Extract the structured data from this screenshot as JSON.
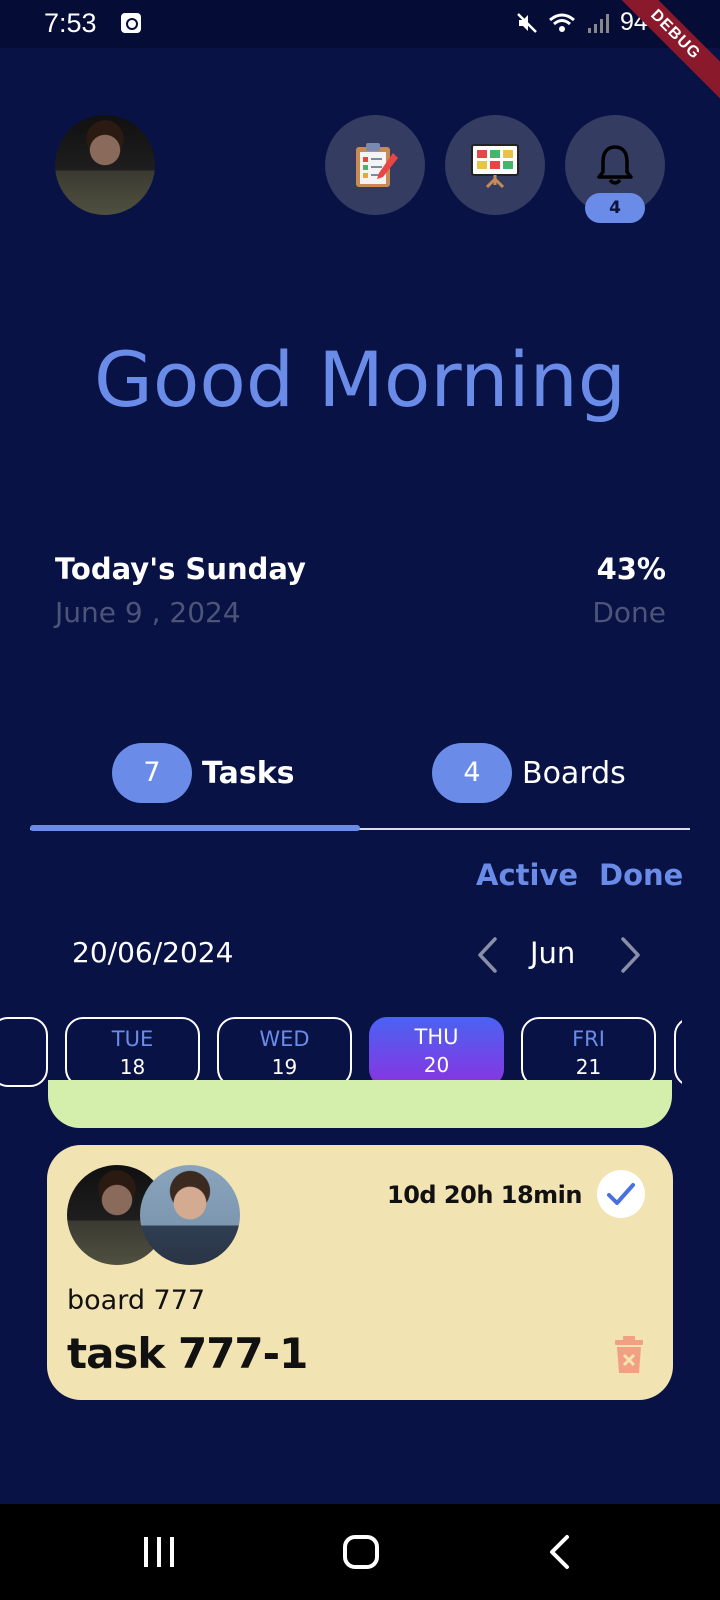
{
  "status_bar": {
    "time": "7:53",
    "battery": "94%"
  },
  "debug_banner": "DEBUG",
  "header": {
    "notification_count": "4"
  },
  "greeting": "Good Morning",
  "summary": {
    "day_title": "Today's Sunday",
    "date": "June 9 , 2024",
    "progress_value": "43%",
    "progress_label": "Done"
  },
  "tabs": [
    {
      "count": "7",
      "label": "Tasks",
      "selected": true
    },
    {
      "count": "4",
      "label": "Boards",
      "selected": false
    }
  ],
  "filters": {
    "active": "Active",
    "done": "Done"
  },
  "calendar": {
    "selected_date": "20/06/2024",
    "month": "Jun",
    "days": [
      {
        "name": "TUE",
        "num": "18"
      },
      {
        "name": "WED",
        "num": "19"
      },
      {
        "name": "THU",
        "num": "20",
        "selected": true
      },
      {
        "name": "FRI",
        "num": "21"
      }
    ]
  },
  "task_card": {
    "countdown": "10d 20h 18min",
    "board": "board 777",
    "task": "task 777-1"
  },
  "colors": {
    "background": "#081245",
    "accent": "#6a8ce8",
    "card": "#f2e3b3",
    "card_green": "#d4eeac",
    "selected_day_gradient": [
      "#4a63f2",
      "#8a33e0"
    ]
  },
  "icons": {
    "header": [
      "clipboard-checklist-icon",
      "kanban-board-icon",
      "bell-icon"
    ],
    "nav": [
      "recents-icon",
      "home-icon",
      "back-icon"
    ]
  }
}
